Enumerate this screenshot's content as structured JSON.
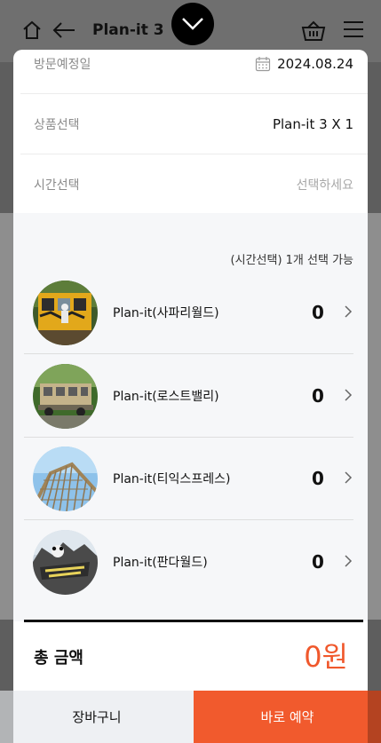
{
  "header": {
    "title": "Plan-it 3",
    "icons": [
      "home-icon",
      "back-arrow-icon",
      "collapse-chevron-icon",
      "cart-icon",
      "menu-icon"
    ]
  },
  "form": {
    "visit_date_label": "방문예정일",
    "visit_date_value": "2024.08.24",
    "product_label": "상품선택",
    "product_value": "Plan-it 3 X 1",
    "time_label": "시간선택",
    "time_placeholder": "선택하세요"
  },
  "options": {
    "hint": "(시간선택) 1개 선택 가능",
    "items": [
      {
        "name": "Plan-it(사파리월드)",
        "qty": "0"
      },
      {
        "name": "Plan-it(로스트밸리)",
        "qty": "0"
      },
      {
        "name": "Plan-it(티익스프레스)",
        "qty": "0"
      },
      {
        "name": "Plan-it(판다월드)",
        "qty": "0"
      }
    ]
  },
  "total": {
    "label": "총 금액",
    "value": "0원"
  },
  "footer": {
    "cart_label": "장바구니",
    "book_label": "바로 예약"
  },
  "colors": {
    "accent": "#f15a2d",
    "total_value": "#f0582c"
  }
}
